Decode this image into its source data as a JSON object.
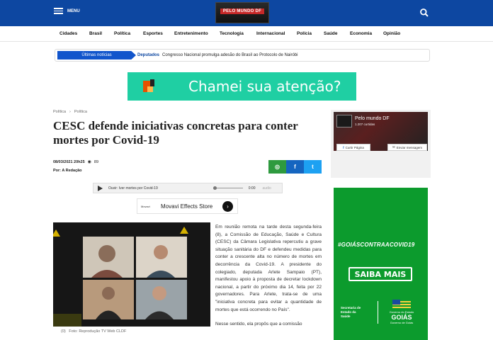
{
  "header": {
    "menu_label": "MENU",
    "logo_text": "PELO MUNDO DF"
  },
  "nav": {
    "items": [
      "Cidades",
      "Brasil",
      "Política",
      "Esportes",
      "Entretenimento",
      "Tecnologia",
      "Internacional",
      "Polícia",
      "Saúde",
      "Economia",
      "Opinião"
    ]
  },
  "ticker": {
    "label": "Últimas notícias",
    "category": "Deputados",
    "headline": "Congresso Nacional promulga adesão do Brasil ao Protocolo de Nairóbi"
  },
  "ad_banner": {
    "text": "Chamei sua atenção?"
  },
  "article": {
    "breadcrumb": [
      "Política",
      "Política"
    ],
    "title": "CESC defende iniciativas concretas para conter mortes por Covid-19",
    "date": "08/03/2021 20h25",
    "views": "89",
    "author": "Por: A Redação",
    "audio_text": "Ouvir: Iver mortes por Covid-19",
    "audio_time": "0:00",
    "audio_extra": "audio",
    "movavi": {
      "brand": "Movavi",
      "text": "Movavi Effects Store"
    },
    "photo_caption": "Foto: Reprodução TV Web CLDF",
    "photo_caption_prefix": "(0)",
    "paragraphs": [
      "Em reunião remota na tarde desta segunda-feira (8), a Comissão de Educação, Saúde e Cultura (CESC) da Câmara Legislativa repercutiu a grave situação sanitária do DF e defendeu medidas para conter a crescente alta no número de mortes em decorrência da Covid-19. A presidente do colegiado, deputada Arlete Sampaio (PT), manifestou apoio à proposta de decretar lockdown nacional, a partir do próximo dia 14, feita por 22 governadores. Para Arlete, trata-se de uma \"iniciativa concreta para evitar a quantidade de mortes que está ocorrendo no País\".",
      "Nesse sentido, ela propôs que a comissão"
    ]
  },
  "share": {
    "whatsapp": "◎",
    "facebook": "f",
    "twitter": "t",
    "colors": {
      "whatsapp": "#2e9a3f",
      "facebook": "#1565c0",
      "twitter": "#1da1f2"
    }
  },
  "sidebar": {
    "facebook_box": {
      "page_name": "Pelo mundo DF",
      "likes": "1.207 curtidas",
      "like_button": "Curtir Página",
      "message_button": "Enviar mensagem"
    },
    "goias_ad": {
      "hashtag": "#GOIÁSCONTRAACOVID19",
      "button": "SAIBA MAIS",
      "secretaria": "Secretaria de Estado da Saúde",
      "state_top": "Governo do Estado",
      "state_name": "GOIÁS",
      "state_bottom": "Governo de Goiás"
    }
  },
  "colors": {
    "topbar": "#0d47a1",
    "ad": "#1fcfa3",
    "goias": "#0c9b2d"
  }
}
